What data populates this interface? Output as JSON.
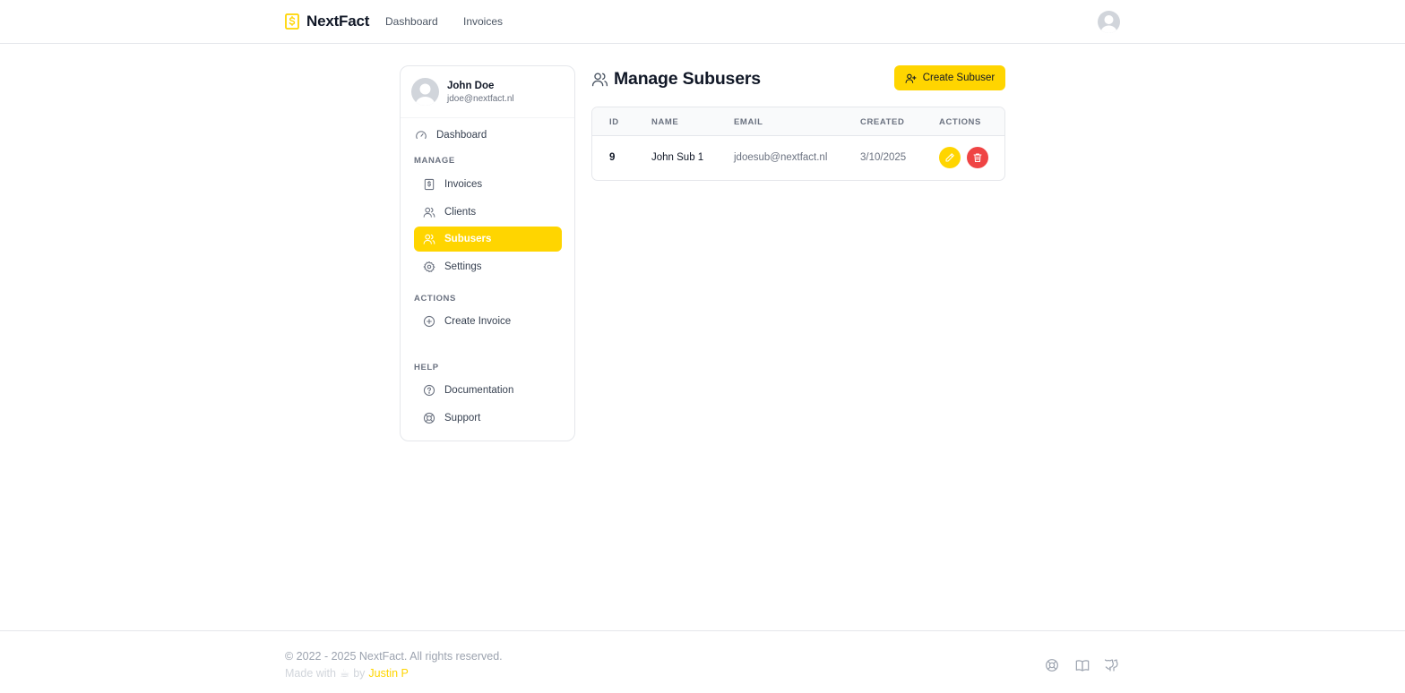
{
  "app": {
    "name": "NextFact"
  },
  "topnav": {
    "links": [
      {
        "label": "Dashboard"
      },
      {
        "label": "Invoices"
      }
    ]
  },
  "sidebar": {
    "user": {
      "name": "John Doe",
      "email": "jdoe@nextfact.nl"
    },
    "dashboard": {
      "label": "Dashboard",
      "icon": "gauge-icon"
    },
    "sections": {
      "manage": "MANAGE",
      "actions": "ACTIONS",
      "help": "HELP"
    },
    "manage_items": [
      {
        "label": "Invoices",
        "icon": "invoice-icon"
      },
      {
        "label": "Clients",
        "icon": "users-icon"
      },
      {
        "label": "Subusers",
        "icon": "users-icon",
        "active": true
      },
      {
        "label": "Settings",
        "icon": "gear-icon"
      }
    ],
    "action_items": [
      {
        "label": "Create Invoice",
        "icon": "plus-circle-icon"
      }
    ],
    "help_items": [
      {
        "label": "Documentation",
        "icon": "question-circle-icon"
      },
      {
        "label": "Support",
        "icon": "lifebuoy-icon"
      }
    ]
  },
  "main": {
    "title": "Manage Subusers",
    "create_button": "Create Subuser",
    "table": {
      "headers": [
        "ID",
        "NAME",
        "EMAIL",
        "CREATED",
        "ACTIONS"
      ],
      "rows": [
        {
          "id": "9",
          "name": "John Sub 1",
          "email": "jdoesub@nextfact.nl",
          "created": "3/10/2025"
        }
      ]
    }
  },
  "footer": {
    "copyright": "© 2022 - 2025 NextFact. All rights reserved.",
    "made_with": "Made with",
    "made_with_icon": "☕",
    "by": "by",
    "author": "Justin P",
    "icons": [
      "lifebuoy-icon",
      "book-icon",
      "github-icon"
    ]
  },
  "colors": {
    "accent": "#ffd500",
    "danger": "#ef4444",
    "text": "#111827",
    "muted": "#6b7280",
    "border": "#e5e7eb"
  }
}
